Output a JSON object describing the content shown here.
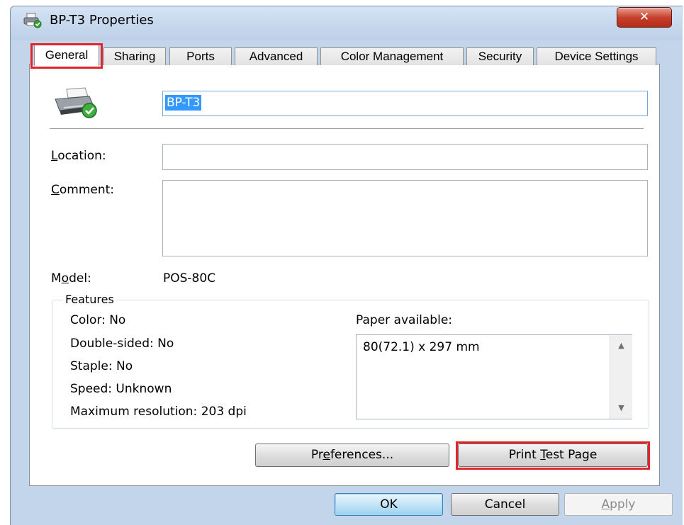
{
  "window": {
    "title": "BP-T3 Properties",
    "close_label": "✕"
  },
  "tabs": [
    {
      "label": "General",
      "active": true,
      "highlighted": true
    },
    {
      "label": "Sharing"
    },
    {
      "label": "Ports"
    },
    {
      "label": "Advanced"
    },
    {
      "label": "Color Management"
    },
    {
      "label": "Security"
    },
    {
      "label": "Device Settings"
    }
  ],
  "general": {
    "printer_icon": "printer-ready-icon",
    "printer_name": "BP-T3",
    "location_label_rest": "ocation:",
    "location_label_accel": "L",
    "location_value": "",
    "comment_label_accel": "C",
    "comment_label_rest": "omment:",
    "comment_value": "",
    "model_label_first": "M",
    "model_label_accel": "o",
    "model_label_rest": "del:",
    "model_value": "POS-80C"
  },
  "features": {
    "legend": "Features",
    "color": "Color: No",
    "double_sided": "Double-sided: No",
    "staple": "Staple: No",
    "speed": "Speed: Unknown",
    "max_resolution": "Maximum resolution: 203 dpi",
    "paper_label": "Paper available:",
    "paper_items": [
      "80(72.1) x 297 mm"
    ]
  },
  "buttons": {
    "preferences_pre": "Pr",
    "preferences_accel": "e",
    "preferences_post": "ferences...",
    "print_test_pre": "Print ",
    "print_test_accel": "T",
    "print_test_post": "est Page",
    "ok": "OK",
    "cancel": "Cancel",
    "apply_accel": "A",
    "apply_post": "pply"
  },
  "colors": {
    "highlight": "#e0262c",
    "selection": "#3399ff",
    "window_chrome": "#c3d5ea"
  }
}
